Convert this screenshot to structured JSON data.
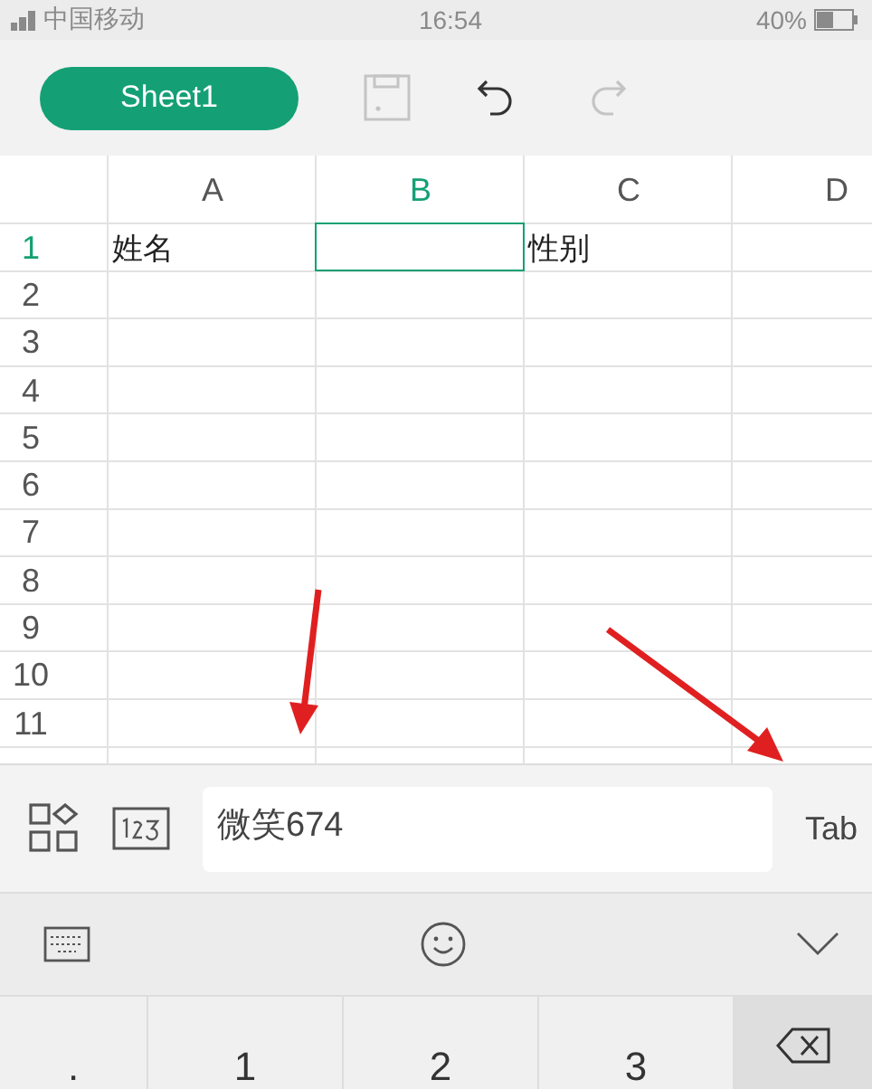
{
  "status_bar": {
    "carrier": "中国移动",
    "time": "16:54",
    "battery": "40%"
  },
  "toolbar": {
    "sheet_tab": "Sheet1",
    "save": {
      "disabled": true
    },
    "undo": {
      "disabled": false
    },
    "redo": {
      "disabled": true
    }
  },
  "grid": {
    "columns": [
      {
        "label": "A",
        "selected": false
      },
      {
        "label": "B",
        "selected": true
      },
      {
        "label": "C",
        "selected": false
      },
      {
        "label": "D",
        "selected": false
      }
    ],
    "rows": [
      {
        "label": "1",
        "selected": true,
        "cells": [
          {
            "text": "姓名",
            "selected": false
          },
          {
            "selected": true
          },
          {
            "text": "性别",
            "selected": false
          }
        ]
      },
      {
        "label": "2",
        "selected": false
      },
      {
        "label": "3",
        "selected": false
      },
      {
        "label": "4",
        "selected": false
      },
      {
        "label": "5",
        "selected": false
      },
      {
        "label": "6",
        "selected": false
      },
      {
        "label": "7",
        "selected": false
      },
      {
        "label": "8",
        "selected": false
      },
      {
        "label": "9",
        "selected": false
      },
      {
        "label": "10",
        "selected": false
      },
      {
        "label": "11",
        "selected": false
      }
    ]
  },
  "input_bar": {
    "value": "微笑674",
    "tab_key": "Tab"
  },
  "keyboard": {
    "keys": [
      {
        "kind": "text",
        "label": "."
      },
      {
        "kind": "text",
        "label": "1"
      },
      {
        "kind": "text",
        "label": "2"
      },
      {
        "kind": "text",
        "label": "3"
      },
      {
        "kind": "delete"
      }
    ]
  }
}
